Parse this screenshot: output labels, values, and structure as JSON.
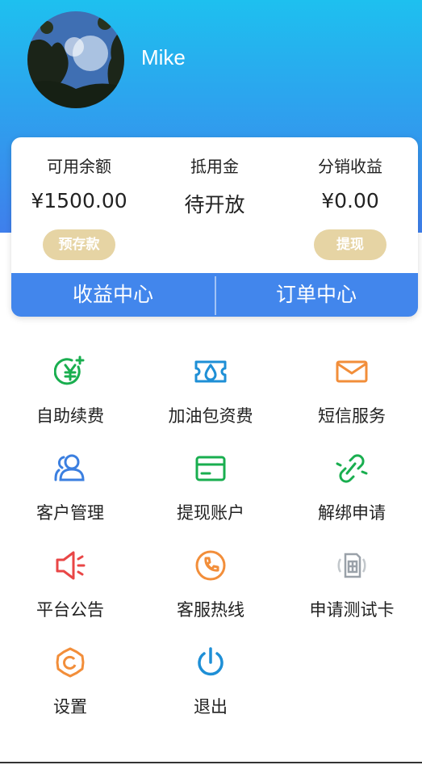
{
  "user": {
    "name": "Mike"
  },
  "balance": {
    "available_label": "可用余额",
    "available_value": "¥1500.00",
    "deposit_button": "预存款",
    "credit_label": "抵用金",
    "credit_value": "待开放",
    "commission_label": "分销收益",
    "commission_value": "¥0.00",
    "withdraw_button": "提现"
  },
  "tabs": {
    "income_center": "收益中心",
    "order_center": "订单中心"
  },
  "menu": [
    {
      "label": "自助续费",
      "icon": "yuan-plus-icon",
      "color": "#19ae4f"
    },
    {
      "label": "加油包资费",
      "icon": "ticket-icon",
      "color": "#1e8fd6"
    },
    {
      "label": "短信服务",
      "icon": "envelope-icon",
      "color": "#f28e3a"
    },
    {
      "label": "客户管理",
      "icon": "users-icon",
      "color": "#3b7fe0"
    },
    {
      "label": "提现账户",
      "icon": "card-icon",
      "color": "#19ae4f"
    },
    {
      "label": "解绑申请",
      "icon": "unlink-icon",
      "color": "#19ae4f"
    },
    {
      "label": "平台公告",
      "icon": "megaphone-icon",
      "color": "#e94646"
    },
    {
      "label": "客服热线",
      "icon": "phone-icon",
      "color": "#f28e3a"
    },
    {
      "label": "申请测试卡",
      "icon": "sim-card-icon",
      "color": "#9aa1a9"
    },
    {
      "label": "设置",
      "icon": "gear-icon",
      "color": "#f28e3a"
    },
    {
      "label": "退出",
      "icon": "power-icon",
      "color": "#1e8fd6"
    }
  ]
}
